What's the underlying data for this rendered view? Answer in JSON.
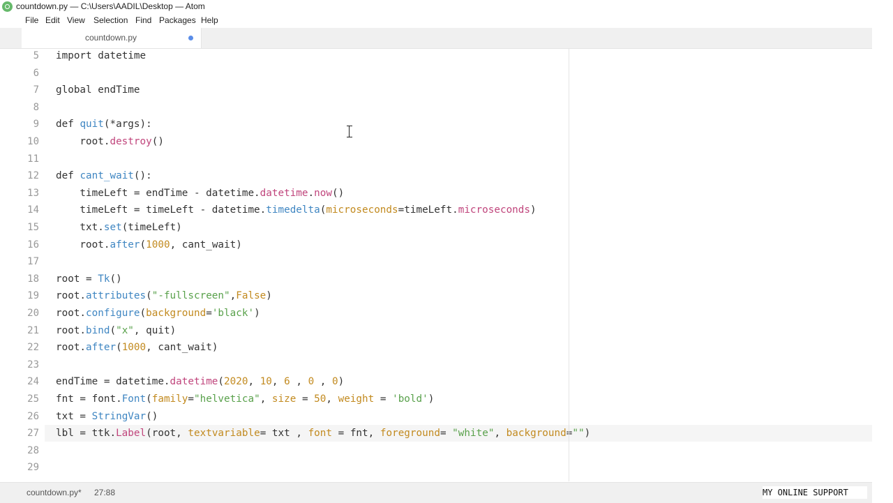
{
  "window": {
    "title": "countdown.py — C:\\Users\\AADIL\\Desktop — Atom"
  },
  "menu": [
    "File",
    "Edit",
    "View",
    "Selection",
    "Find",
    "Packages",
    "Help"
  ],
  "tab": {
    "title": "countdown.py",
    "modified": true
  },
  "editor": {
    "lines": [
      {
        "n": "5",
        "text": "import datetime"
      },
      {
        "n": "6",
        "text": ""
      },
      {
        "n": "7",
        "text": "global endTime"
      },
      {
        "n": "8",
        "text": ""
      },
      {
        "n": "9",
        "text": "def quit(*args):"
      },
      {
        "n": "10",
        "text": "    root.destroy()"
      },
      {
        "n": "11",
        "text": ""
      },
      {
        "n": "12",
        "text": "def cant_wait():"
      },
      {
        "n": "13",
        "text": "    timeLeft = endTime - datetime.datetime.now()"
      },
      {
        "n": "14",
        "text": "    timeLeft = timeLeft - datetime.timedelta(microseconds=timeLeft.microseconds)"
      },
      {
        "n": "15",
        "text": "    txt.set(timeLeft)"
      },
      {
        "n": "16",
        "text": "    root.after(1000, cant_wait)"
      },
      {
        "n": "17",
        "text": ""
      },
      {
        "n": "18",
        "text": "root = Tk()"
      },
      {
        "n": "19",
        "text": "root.attributes(\"-fullscreen\",False)"
      },
      {
        "n": "20",
        "text": "root.configure(background='black')"
      },
      {
        "n": "21",
        "text": "root.bind(\"x\", quit)"
      },
      {
        "n": "22",
        "text": "root.after(1000, cant_wait)"
      },
      {
        "n": "23",
        "text": ""
      },
      {
        "n": "24",
        "text": "endTime = datetime.datetime(2020, 10, 6 , 0 , 0)"
      },
      {
        "n": "25",
        "text": "fnt = font.Font(family=\"helvetica\", size = 50, weight = 'bold')"
      },
      {
        "n": "26",
        "text": "txt = StringVar()"
      },
      {
        "n": "27",
        "text": "lbl = ttk.Label(root, textvariable= txt , font = fnt, foreground= \"white\", background=\"\")"
      },
      {
        "n": "28",
        "text": ""
      },
      {
        "n": "29",
        "text": ""
      }
    ],
    "active_line": "27"
  },
  "status": {
    "file": "countdown.py*",
    "cursor": "27:88"
  },
  "watermark": "MY ONLINE SUPPORT",
  "colors": {
    "keyword": "#333333",
    "method": "#3f86c2",
    "property": "#c0457c",
    "number": "#c28a1f",
    "string": "#59a14b",
    "modified_dot": "#5a8de8"
  }
}
